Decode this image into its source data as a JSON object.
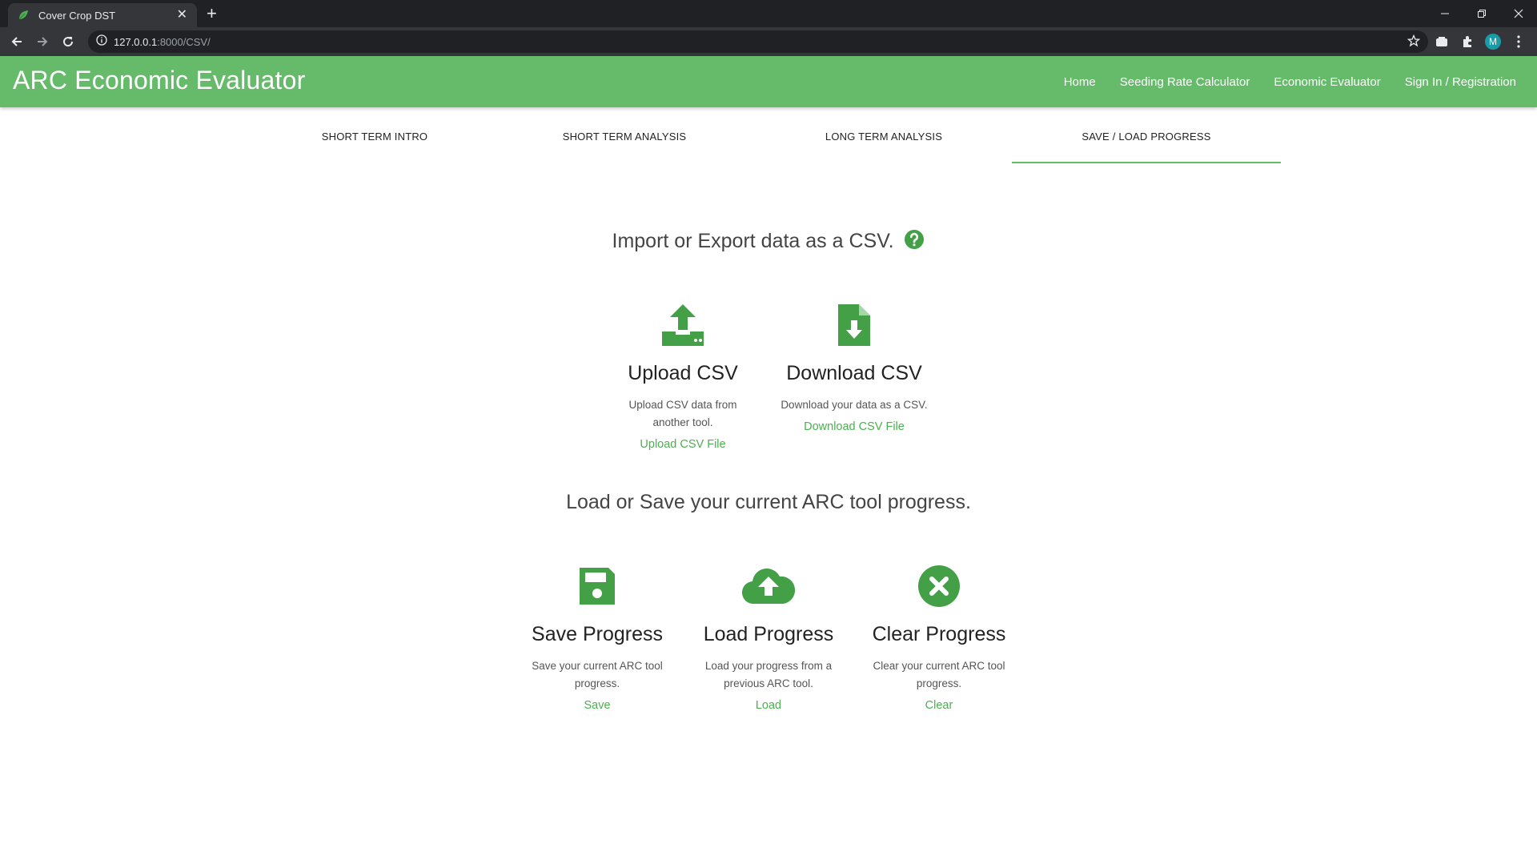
{
  "browser": {
    "tab_title": "Cover Crop DST",
    "url_host": "127.0.0.1",
    "url_rest": ":8000/CSV/",
    "profile_initial": "M"
  },
  "header": {
    "brand": "ARC Economic Evaluator",
    "nav": [
      "Home",
      "Seeding Rate Calculator",
      "Economic Evaluator",
      "Sign In / Registration"
    ]
  },
  "tabs": {
    "items": [
      "SHORT TERM INTRO",
      "SHORT TERM ANALYSIS",
      "LONG TERM ANALYSIS",
      "SAVE / LOAD PROGRESS"
    ],
    "active": "SAVE / LOAD PROGRESS"
  },
  "csv_section": {
    "heading": "Import or Export data as a CSV.",
    "cards": [
      {
        "icon": "upload-tray-icon",
        "title": "Upload CSV",
        "desc": "Upload CSV data from another tool.",
        "link": "Upload CSV File"
      },
      {
        "icon": "file-download-icon",
        "title": "Download CSV",
        "desc": "Download your data as a CSV.",
        "link": "Download CSV File"
      }
    ]
  },
  "progress_section": {
    "heading": "Load or Save your current ARC tool progress.",
    "cards": [
      {
        "icon": "floppy-disk-icon",
        "title": "Save Progress",
        "desc": "Save your current ARC tool progress.",
        "link": "Save"
      },
      {
        "icon": "cloud-upload-icon",
        "title": "Load Progress",
        "desc": "Load your progress from a previous ARC tool.",
        "link": "Load"
      },
      {
        "icon": "close-circle-icon",
        "title": "Clear Progress",
        "desc": "Clear your current ARC tool progress.",
        "link": "Clear"
      }
    ]
  },
  "colors": {
    "brand_green": "#66bb6a",
    "link_green": "#4caf50",
    "icon_green": "#43a047"
  }
}
